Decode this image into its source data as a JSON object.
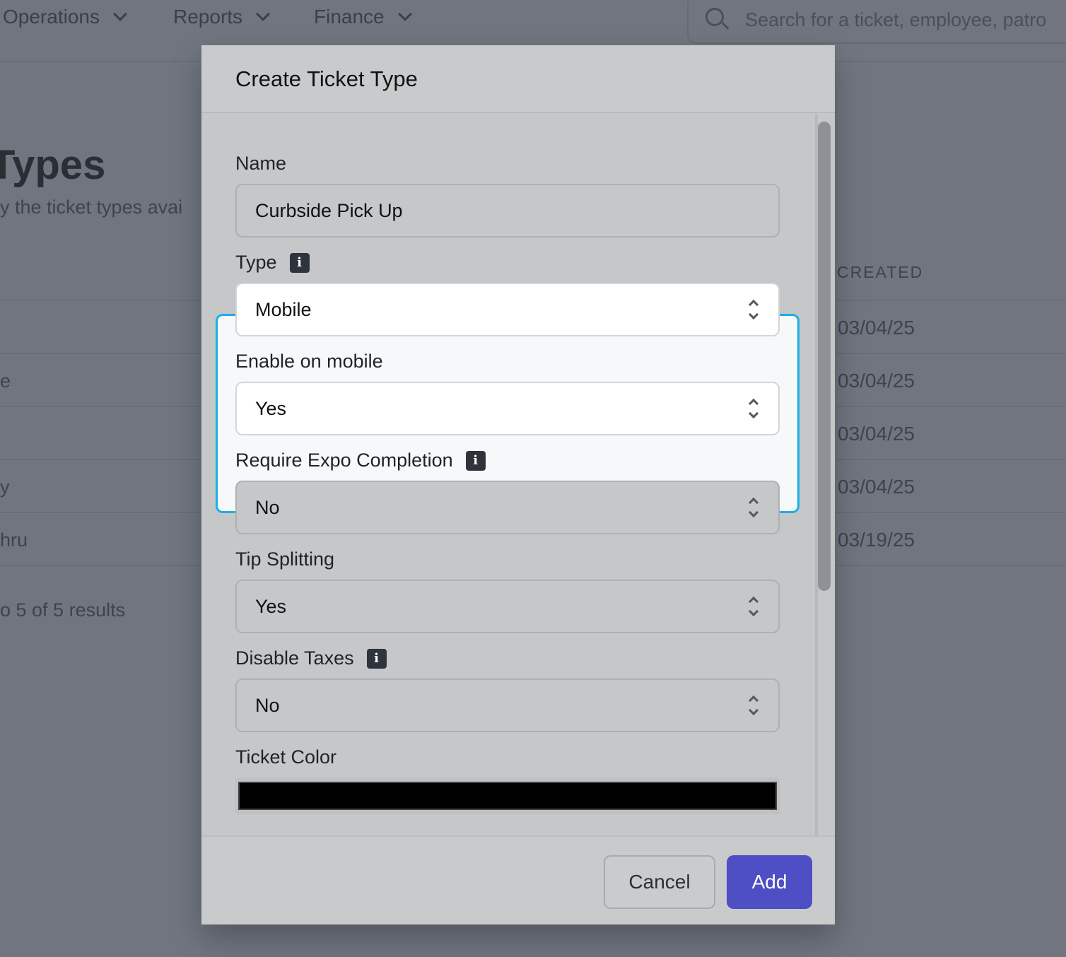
{
  "nav": {
    "items": [
      "Operations",
      "Reports",
      "Finance"
    ],
    "search_placeholder": "Search for a ticket, employee, patro"
  },
  "page": {
    "title": "Types",
    "subtitle": "y the ticket types avai",
    "column_header": "CREATED",
    "rows": [
      {
        "left": "",
        "date": "03/04/25"
      },
      {
        "left": "e",
        "date": "03/04/25"
      },
      {
        "left": "",
        "date": "03/04/25"
      },
      {
        "left": "y",
        "date": "03/04/25"
      },
      {
        "left": "hru",
        "date": "03/19/25"
      }
    ],
    "results_text": "o 5 of 5 results"
  },
  "modal": {
    "title": "Create Ticket Type",
    "name_label": "Name",
    "name_value": "Curbside Pick Up",
    "type_label": "Type",
    "type_value": "Mobile",
    "enable_mobile_label": "Enable on mobile",
    "enable_mobile_value": "Yes",
    "expo_label": "Require Expo Completion",
    "expo_value": "No",
    "tip_label": "Tip Splitting",
    "tip_value": "Yes",
    "taxes_label": "Disable Taxes",
    "taxes_value": "No",
    "color_label": "Ticket Color",
    "color_value": "#000000",
    "info_glyph": "i",
    "cancel_label": "Cancel",
    "add_label": "Add"
  },
  "colors": {
    "accent": "#4e4ec5",
    "highlight": "#1ab0e6"
  }
}
